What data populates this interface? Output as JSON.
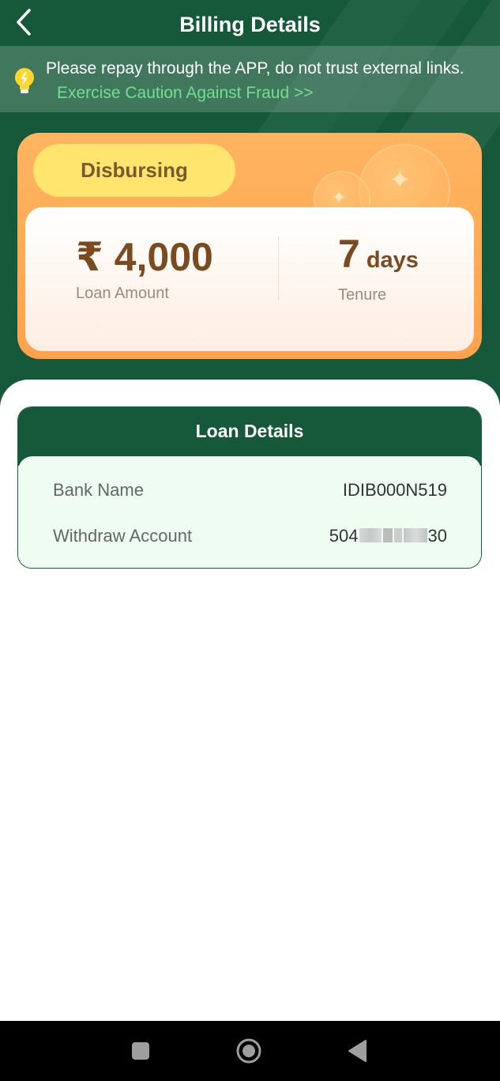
{
  "header": {
    "title": "Billing Details",
    "back_icon": "chevron-left-icon"
  },
  "notice": {
    "icon": "lightbulb-icon",
    "message": "Please repay through the APP, do not trust external links.",
    "link": "Exercise Caution Against Fraud >>"
  },
  "status_card": {
    "status": "Disbursing",
    "amount": "₹ 4,000",
    "amount_label": "Loan Amount",
    "tenure_value": "7",
    "tenure_unit": "days",
    "tenure_label": "Tenure"
  },
  "loan_details": {
    "title": "Loan Details",
    "rows": [
      {
        "label": "Bank Name",
        "value": "IDIB000N519"
      },
      {
        "label": "Withdraw Account",
        "value_prefix": "504",
        "value_suffix": "30"
      }
    ]
  },
  "nav_bar": {
    "recent_icon": "square-icon",
    "home_icon": "circle-icon",
    "back_icon": "triangle-back-icon"
  },
  "colors": {
    "primary_green": "#16593a",
    "accent_green": "#6fe08d",
    "orange": "#ffa24e",
    "pill_yellow": "#ffe56e",
    "brown_text": "#7b4a1f"
  }
}
